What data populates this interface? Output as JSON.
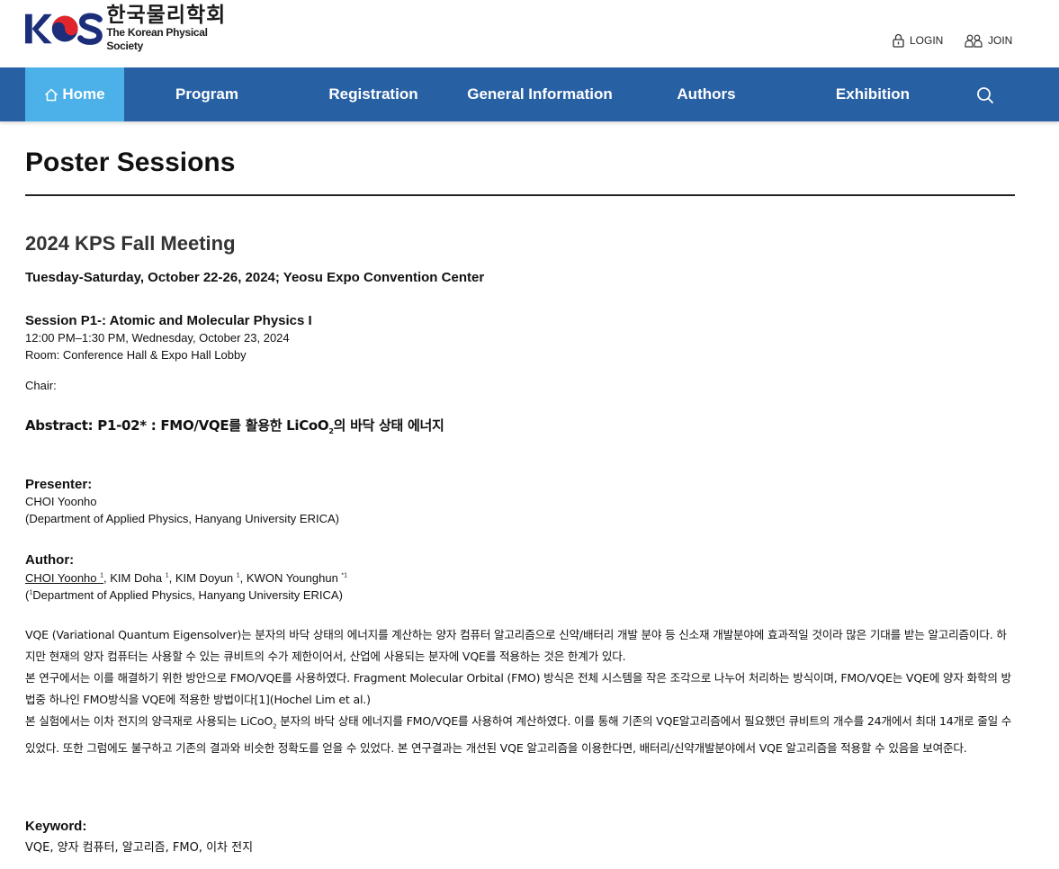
{
  "header": {
    "logo_ko": "한국물리학회",
    "logo_en": "The Korean Physical Society",
    "logo_mark": "KPS",
    "login_label": "LOGIN",
    "join_label": "JOIN"
  },
  "nav": {
    "items": [
      {
        "label": "Home"
      },
      {
        "label": "Program"
      },
      {
        "label": "Registration"
      },
      {
        "label": "General Information"
      },
      {
        "label": "Authors"
      },
      {
        "label": "Exhibition"
      }
    ]
  },
  "page": {
    "title": "Poster Sessions",
    "meeting": "2024 KPS Fall Meeting",
    "meeting_info": "Tuesday-Saturday, October 22-26, 2024; Yeosu Expo Convention Center"
  },
  "session": {
    "title": "Session P1-: Atomic and Molecular Physics I",
    "time": "12:00 PM–1:30 PM, Wednesday, October 23, 2024",
    "room": "Room: Conference Hall & Expo Hall Lobby",
    "chair": "Chair:"
  },
  "abstract": {
    "title_pre": "Abstract: P1-02* : FMO/VQE를 활용한 LiCoO",
    "title_sub": "2",
    "title_post": "의 바닥 상태 에너지",
    "presenter_label": "Presenter:",
    "presenter_name": "CHOI Yoonho",
    "presenter_affiliation": "(Department of Applied Physics, Hanyang University ERICA)",
    "author_label": "Author:",
    "authors": [
      {
        "name": "CHOI Yoonho ",
        "sup": "1"
      },
      {
        "name": "KIM Doha ",
        "sup": "1"
      },
      {
        "name": "KIM Doyun ",
        "sup": "1"
      },
      {
        "name": "KWON Younghun ",
        "sup": "*1"
      }
    ],
    "author_aff_pre": "(",
    "author_aff_sup": "1",
    "author_aff_text": "Department of Applied Physics, Hanyang University ERICA)",
    "paragraph1": "VQE (Variational Quantum Eigensolver)는 분자의 바닥 상태의 에너지를 계산하는 양자 컴퓨터 알고리즘으로 신약/배터리 개발 분야 등 신소재 개발분야에 효과적일 것이라 많은 기대를 받는 알고리즘이다. 하지만 현재의 양자 컴퓨터는 사용할 수 있는 큐비트의 수가 제한이어서, 산업에 사용되는 분자에 VQE를 적용하는 것은 한계가 있다.",
    "paragraph2": "본 연구에서는 이를 해결하기 위한 방안으로 FMO/VQE를 사용하였다. Fragment Molecular Orbital (FMO) 방식은 전체 시스템을 작은 조각으로 나누어 처리하는 방식이며, FMO/VQE는 VQE에 양자 화학의 방법중 하나인 FMO방식을 VQE에 적용한 방법이다[1](Hochel Lim et al.)",
    "paragraph3_pre": "본 실험에서는 이차 전지의 양극재로 사용되는 LiCoO",
    "paragraph3_sub": "2",
    "paragraph3_post": " 분자의 바닥 상태 에너지를 FMO/VQE를 사용하여 계산하였다. 이를 통해 기존의 VQE알고리즘에서 필요했던 큐비트의 개수를 24개에서 최대 14개로 줄일 수 있었다. 또한 그럼에도 불구하고 기존의 결과와 비슷한 정확도를 얻을 수 있었다. 본 연구결과는 개선된 VQE 알고리즘을 이용한다면, 배터리/신약개발분야에서 VQE 알고리즘을 적용할 수 있음을 보여준다.",
    "keyword_label": "Keyword:",
    "keywords": "VQE, 양자 컴퓨터, 알고리즘, FMO, 이차 전지"
  },
  "colors": {
    "nav_bg": "#2860a4",
    "nav_active": "#4cb1e8",
    "logo_navy": "#1c2e7a",
    "logo_red": "#e0262c"
  },
  "icons": {
    "login": "lock-icon",
    "join": "users-icon",
    "home": "home-icon",
    "search": "search-icon"
  }
}
